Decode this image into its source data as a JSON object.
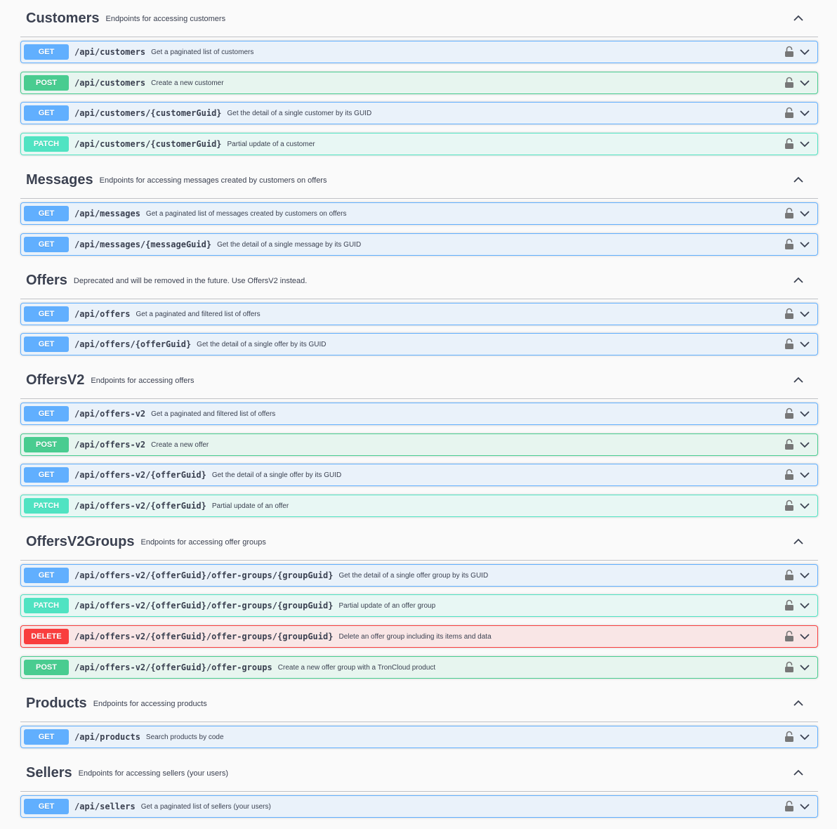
{
  "sections": [
    {
      "title": "Customers",
      "description": "Endpoints for accessing customers",
      "operations": [
        {
          "method": "GET",
          "path": "/api/customers",
          "summary": "Get a paginated list of customers"
        },
        {
          "method": "POST",
          "path": "/api/customers",
          "summary": "Create a new customer"
        },
        {
          "method": "GET",
          "path": "/api/customers/{customerGuid}",
          "summary": "Get the detail of a single customer by its GUID"
        },
        {
          "method": "PATCH",
          "path": "/api/customers/{customerGuid}",
          "summary": "Partial update of a customer"
        }
      ]
    },
    {
      "title": "Messages",
      "description": "Endpoints for accessing messages created by customers on offers",
      "operations": [
        {
          "method": "GET",
          "path": "/api/messages",
          "summary": "Get a paginated list of messages created by customers on offers"
        },
        {
          "method": "GET",
          "path": "/api/messages/{messageGuid}",
          "summary": "Get the detail of a single message by its GUID"
        }
      ]
    },
    {
      "title": "Offers",
      "description": "Deprecated and will be removed in the future. Use OffersV2 instead.",
      "operations": [
        {
          "method": "GET",
          "path": "/api/offers",
          "summary": "Get a paginated and filtered list of offers"
        },
        {
          "method": "GET",
          "path": "/api/offers/{offerGuid}",
          "summary": "Get the detail of a single offer by its GUID"
        }
      ]
    },
    {
      "title": "OffersV2",
      "description": "Endpoints for accessing offers",
      "operations": [
        {
          "method": "GET",
          "path": "/api/offers-v2",
          "summary": "Get a paginated and filtered list of offers"
        },
        {
          "method": "POST",
          "path": "/api/offers-v2",
          "summary": "Create a new offer"
        },
        {
          "method": "GET",
          "path": "/api/offers-v2/{offerGuid}",
          "summary": "Get the detail of a single offer by its GUID"
        },
        {
          "method": "PATCH",
          "path": "/api/offers-v2/{offerGuid}",
          "summary": "Partial update of an offer"
        }
      ]
    },
    {
      "title": "OffersV2Groups",
      "description": "Endpoints for accessing offer groups",
      "operations": [
        {
          "method": "GET",
          "path": "/api/offers-v2/{offerGuid}/offer-groups/{groupGuid}",
          "summary": "Get the detail of a single offer group by its GUID"
        },
        {
          "method": "PATCH",
          "path": "/api/offers-v2/{offerGuid}/offer-groups/{groupGuid}",
          "summary": "Partial update of an offer group"
        },
        {
          "method": "DELETE",
          "path": "/api/offers-v2/{offerGuid}/offer-groups/{groupGuid}",
          "summary": "Delete an offer group including its items and data"
        },
        {
          "method": "POST",
          "path": "/api/offers-v2/{offerGuid}/offer-groups",
          "summary": "Create a new offer group with a TronCloud product"
        }
      ]
    },
    {
      "title": "Products",
      "description": "Endpoints for accessing products",
      "operations": [
        {
          "method": "GET",
          "path": "/api/products",
          "summary": "Search products by code"
        }
      ]
    },
    {
      "title": "Sellers",
      "description": "Endpoints for accessing sellers (your users)",
      "operations": [
        {
          "method": "GET",
          "path": "/api/sellers",
          "summary": "Get a paginated list of sellers (your users)"
        }
      ]
    }
  ],
  "colors": {
    "get": "#61affe",
    "post": "#49cc90",
    "patch": "#50e3c2",
    "delete": "#f93e3e",
    "text": "#3b4151",
    "background": "#fafafa"
  },
  "icons": {
    "section_toggle": "chevron-up-icon",
    "operation_lock": "lock-icon",
    "operation_expand": "chevron-down-icon"
  }
}
